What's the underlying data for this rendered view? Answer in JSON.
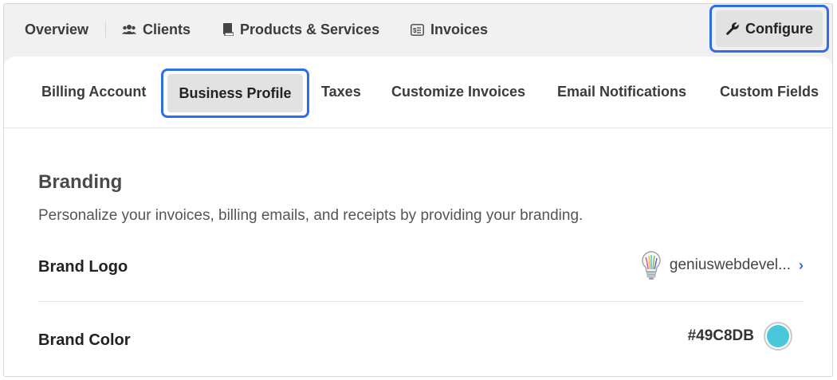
{
  "topnav": {
    "items": [
      {
        "label": "Overview",
        "icon": "none"
      },
      {
        "label": "Clients",
        "icon": "users-icon"
      },
      {
        "label": "Products & Services",
        "icon": "book-icon"
      },
      {
        "label": "Invoices",
        "icon": "invoice-icon"
      }
    ],
    "configure_label": "Configure",
    "configure_icon": "wrench-icon"
  },
  "subtabs": [
    {
      "label": "Billing Account"
    },
    {
      "label": "Business Profile",
      "selected": true
    },
    {
      "label": "Taxes"
    },
    {
      "label": "Customize Invoices"
    },
    {
      "label": "Email Notifications"
    },
    {
      "label": "Custom Fields"
    }
  ],
  "branding": {
    "title": "Branding",
    "description": "Personalize your invoices, billing emails, and receipts by providing your branding.",
    "logo_label": "Brand Logo",
    "logo_value": "geniuswebdevel...",
    "color_label": "Brand Color",
    "color_value": "#49C8DB",
    "color_hex": "#49C8DB"
  },
  "colors": {
    "highlight": "#2f6ee6",
    "selected_bg": "#e2e2e2",
    "chevron": "#2f6ee6"
  }
}
